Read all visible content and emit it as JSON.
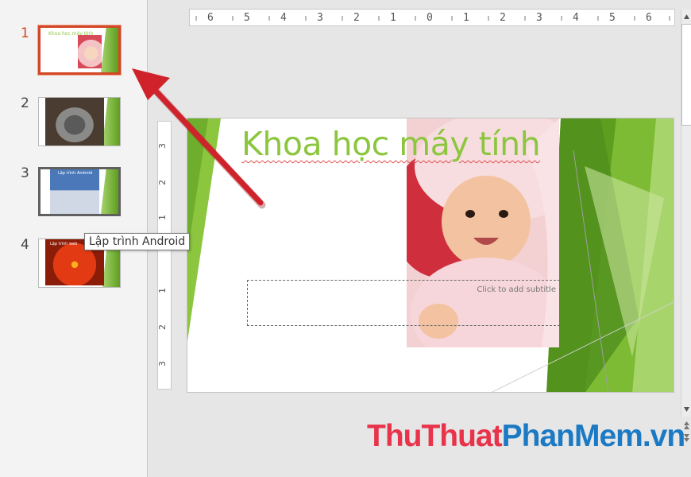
{
  "thumbnails": [
    {
      "number": "1",
      "mini_title": "Khoa học máy tính",
      "selected": true
    },
    {
      "number": "2",
      "selected": false
    },
    {
      "number": "3",
      "mini_title": "Lập trình Android",
      "selected": false,
      "hover": true
    },
    {
      "number": "4",
      "mini_title": "Lập trình web",
      "selected": false
    }
  ],
  "tooltip": "Lập trình Android",
  "ruler": {
    "horizontal": [
      "6",
      "5",
      "4",
      "3",
      "2",
      "1",
      "0",
      "1",
      "2",
      "3",
      "4",
      "5",
      "6"
    ],
    "vertical": [
      "3",
      "2",
      "1",
      "1",
      "2",
      "3"
    ]
  },
  "slide": {
    "title": "Khoa học máy tính",
    "subtitle_placeholder": "Click to add subtitle"
  },
  "watermark": {
    "part1": "ThuThuat",
    "part2": "PhanMem",
    "part3": ".vn"
  },
  "colors": {
    "accent_green": "#8cc63f",
    "selection": "#d24726",
    "arrow": "#d0222b"
  }
}
